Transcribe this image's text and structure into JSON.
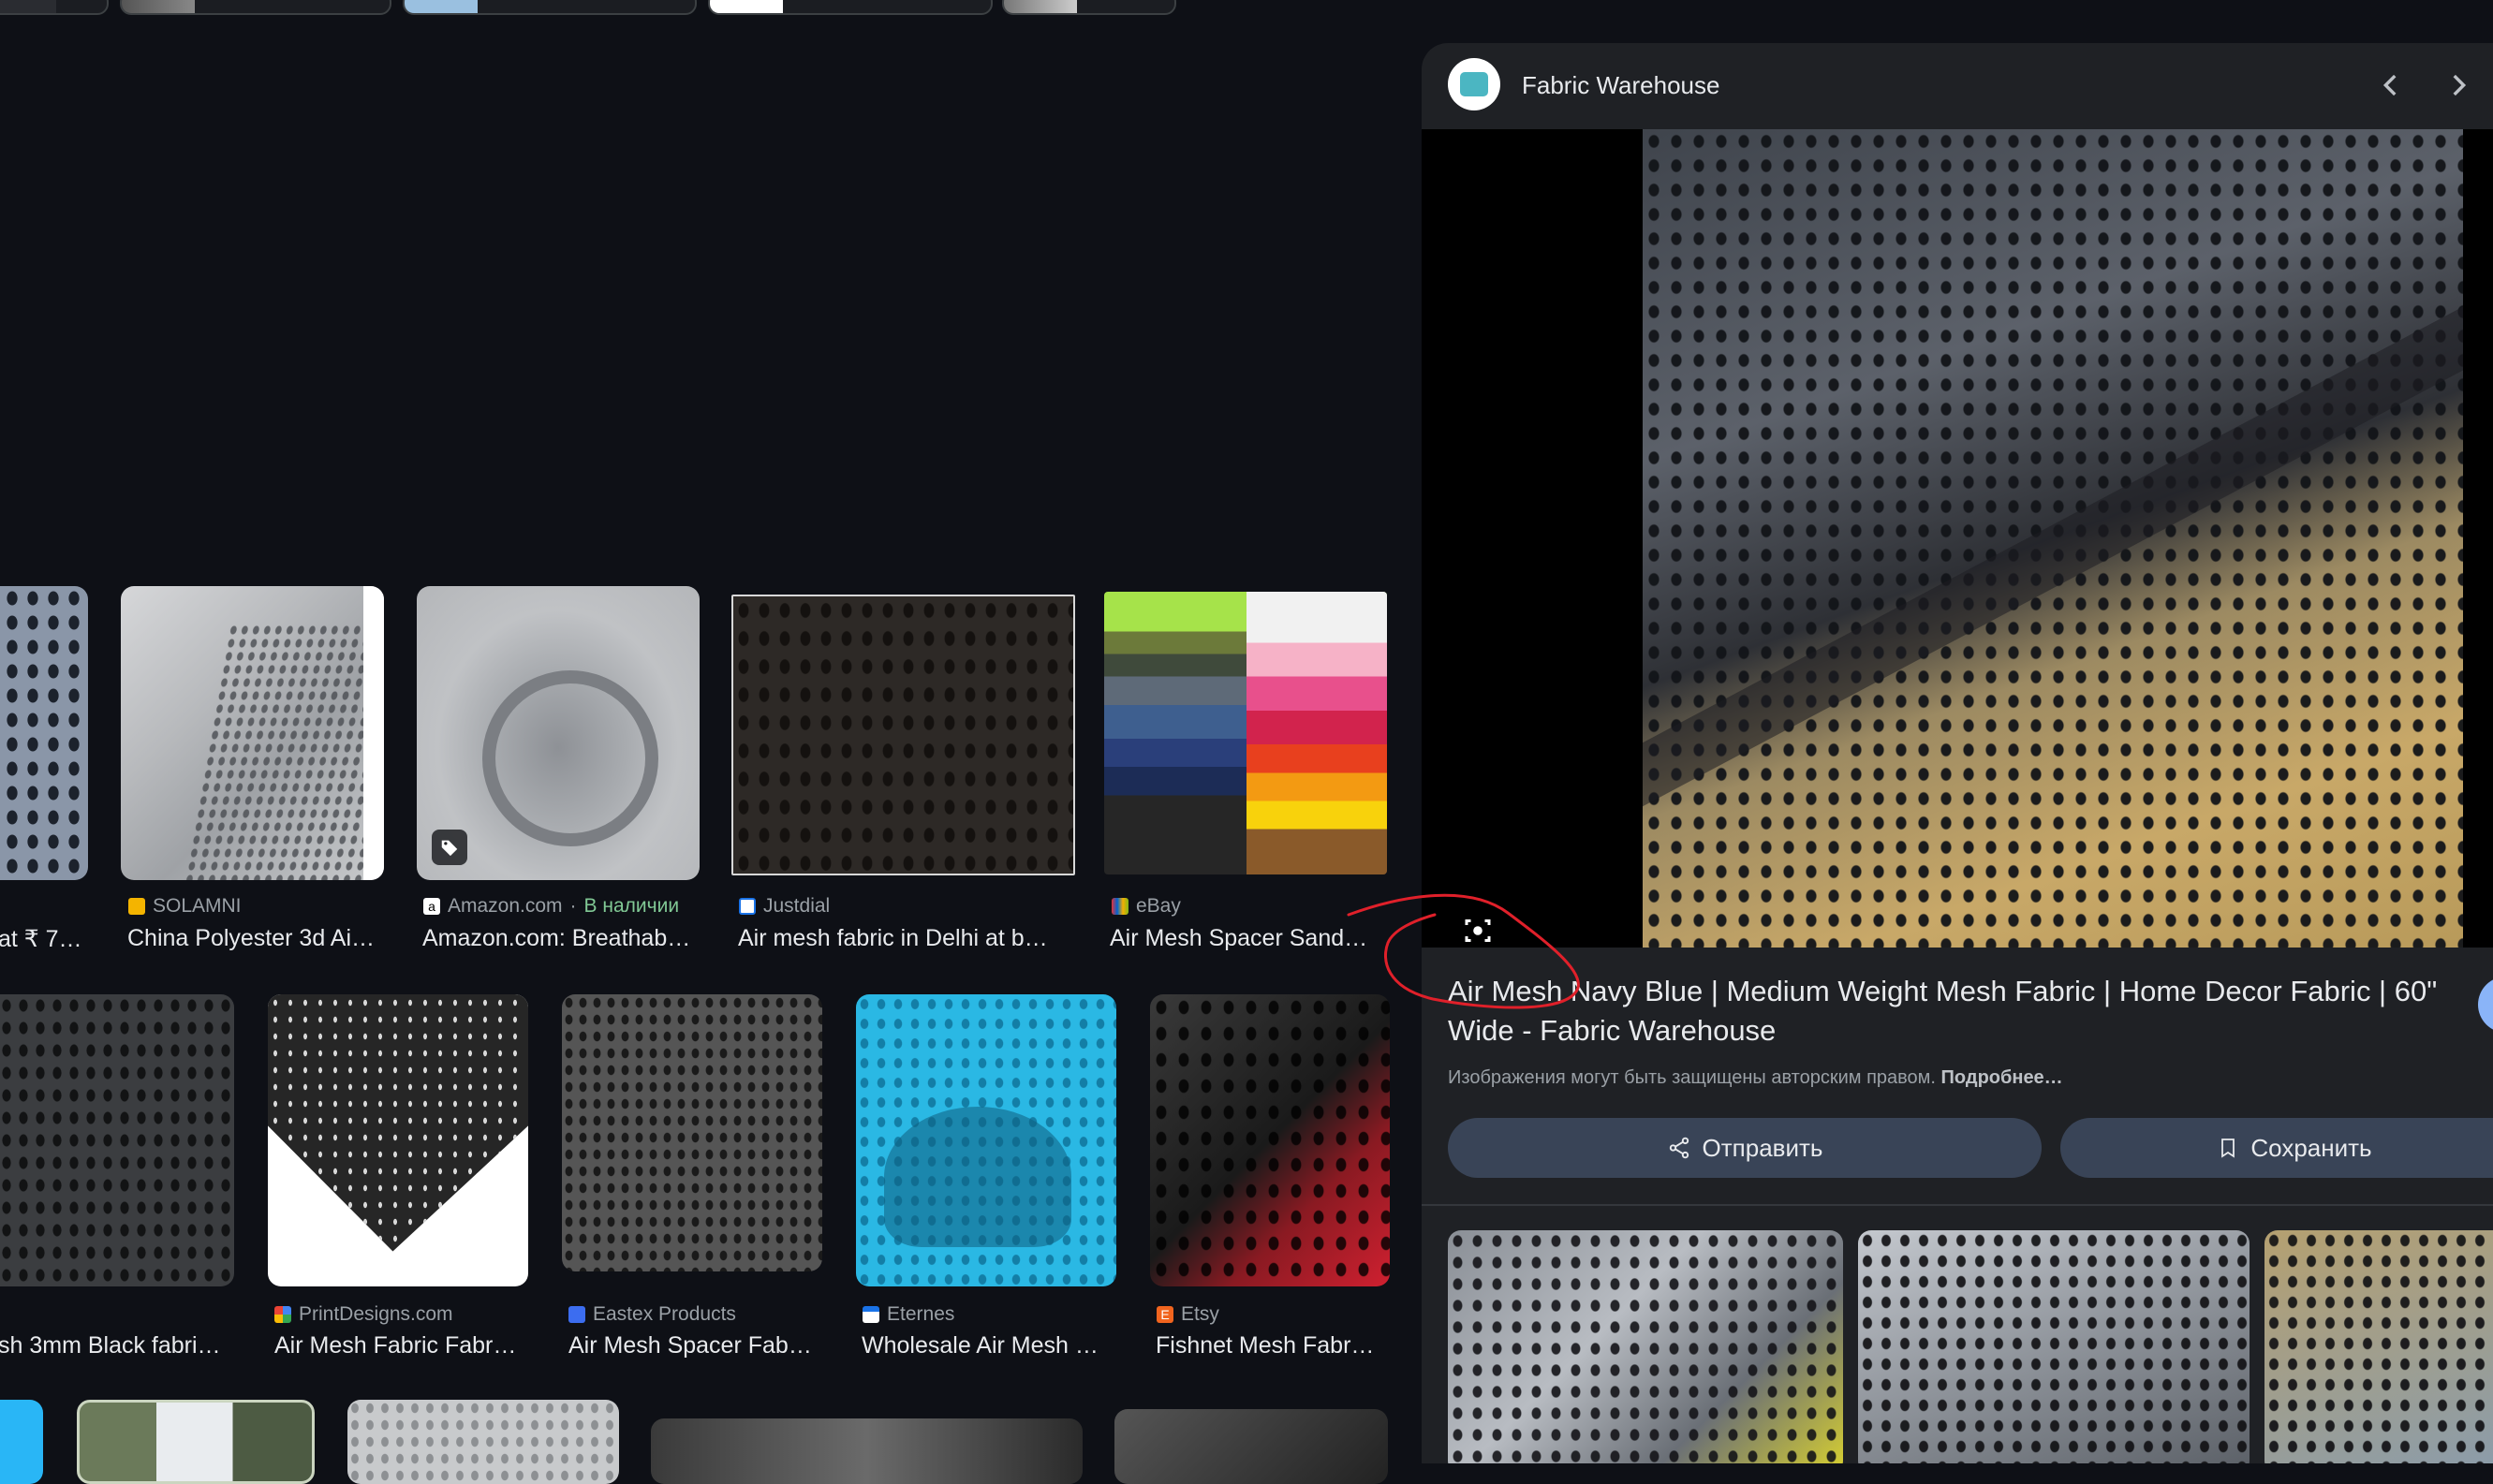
{
  "filter_chips": [
    {
      "label": ""
    },
    {
      "label": ""
    },
    {
      "label": ""
    },
    {
      "label": ""
    },
    {
      "label": ""
    }
  ],
  "row1": [
    {
      "source": "",
      "title": "at ₹ 7…",
      "fav": "#888"
    },
    {
      "source": "SOLAMNI",
      "title": "China Polyester 3d Ai…",
      "fav": "#f4b400"
    },
    {
      "source": "Amazon.com",
      "stock": "В наличии",
      "title": "Amazon.com: Breathab…",
      "fav": "#ffffff"
    },
    {
      "source": "Justdial",
      "title": "Air mesh fabric in Delhi at b…",
      "fav": "#1a73e8"
    },
    {
      "source": "eBay",
      "title": "Air Mesh Spacer Sand…",
      "fav": "#e53238"
    }
  ],
  "row2": [
    {
      "source": "",
      "title": "sh 3mm Black fabri…",
      "fav": "#888"
    },
    {
      "source": "PrintDesigns.com",
      "title": "Air Mesh Fabric Fabr…",
      "fav": "#4285f4"
    },
    {
      "source": "Eastex Products",
      "title": "Air Mesh Spacer Fab…",
      "fav": "#3c6df0"
    },
    {
      "source": "Eternes",
      "title": "Wholesale Air Mesh …",
      "fav": "#ffffff"
    },
    {
      "source": "Etsy",
      "title": "Fishnet Mesh Fabr…",
      "fav": "#f1641e"
    }
  ],
  "panel": {
    "site_name": "Fabric Warehouse",
    "title": "Air Mesh Navy Blue | Medium Weight Mesh Fabric | Home Decor Fabric | 60\" Wide - Fabric Warehouse",
    "copyright": "Изображения могут быть защищены авторским правом.",
    "more": "Подробнее…",
    "share": "Отправить",
    "save": "Сохранить"
  },
  "icons": [
    "lens-icon",
    "chevron-left-icon",
    "chevron-right-icon",
    "share-icon",
    "bookmark-icon",
    "tag-icon"
  ],
  "colors": {
    "background": "#0e1016",
    "panel": "#1f2125",
    "button": "#394457",
    "stock": "#81c995",
    "annotation": "#e0202a"
  }
}
